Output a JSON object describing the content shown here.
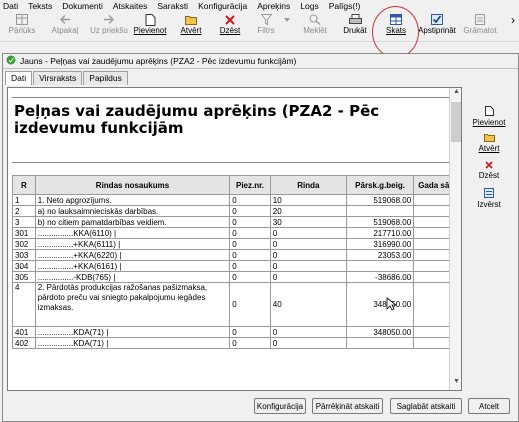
{
  "menu": [
    "Dati",
    "Teksts",
    "Dokumenti",
    "Atskaites",
    "Saraksti",
    "Konfigurācija",
    "Apreķins",
    "Logs",
    "Palīgs(!)"
  ],
  "toolbar": {
    "items": [
      {
        "label": "Pārlūks",
        "icon": "grid-icon",
        "enabled": false
      },
      {
        "label": "Atpakaļ",
        "icon": "arrow-left-icon",
        "enabled": false
      },
      {
        "label": "Uz priekšu",
        "icon": "arrow-right-icon",
        "enabled": false
      },
      {
        "label": "Pievienot",
        "icon": "new-document-icon",
        "enabled": true
      },
      {
        "label": "Atvērt",
        "icon": "open-folder-icon",
        "enabled": true
      },
      {
        "label": "Dzēst",
        "icon": "delete-icon",
        "enabled": true
      },
      {
        "label": "Filtrs",
        "icon": "filter-icon",
        "enabled": false
      },
      {
        "label": "Meklēt",
        "icon": "search-icon",
        "enabled": false
      },
      {
        "label": "Drukāt",
        "icon": "printer-icon",
        "enabled": true
      },
      {
        "label": "Skats",
        "icon": "table-view-icon",
        "enabled": true
      },
      {
        "label": "Apstiprināt",
        "icon": "approve-icon",
        "enabled": true
      },
      {
        "label": "Grāmatot",
        "icon": "ledger-icon",
        "enabled": false
      }
    ]
  },
  "window": {
    "title": "Jauns - Peļņas vai zaudējumu aprēķins (PZA2 - Pēc izdevumu funkcijām)",
    "tabs": [
      "Dati",
      "Virsraksts",
      "Papildus"
    ]
  },
  "report": {
    "title": "Peļņas vai zaudējumu aprēķins (PZA2 - Pēc izdevumu funkcijām",
    "headers": [
      "R",
      "Rindas nosaukums",
      "Piez.nr.",
      "Rinda",
      "Pārsk.g.beig.",
      "Gada sāk."
    ],
    "rows": [
      [
        "1",
        "1. Neto apgrozījums.",
        "0",
        "10",
        "519068.00",
        ""
      ],
      [
        "2",
        "a) no lauksaimnieciskās darbības.",
        "0",
        "20",
        "",
        ""
      ],
      [
        "3",
        "b) no citiem pamatdarbības veidiem.",
        "0",
        "30",
        "519068.00",
        ""
      ],
      [
        "301",
        "................KKA(6110) |",
        "0",
        "0",
        "217710.00",
        ""
      ],
      [
        "302",
        "................+KKA(6111) |",
        "0",
        "0",
        "316990.00",
        ""
      ],
      [
        "303",
        "................+KKA(6220) |",
        "0",
        "0",
        "23053.00",
        ""
      ],
      [
        "304",
        "................+KKA(6161) |",
        "0",
        "0",
        "",
        ""
      ],
      [
        "305",
        "................-KDB(765) |",
        "0",
        "0",
        "-38686.00",
        ""
      ],
      [
        "4",
        "2. Pārdotās produkcijas ražošanas pašizmaksa, pārdoto preču vai sniegto pakalpojumu iegādes izmaksas.",
        "0",
        "40",
        "348050.00",
        ""
      ],
      [
        "401",
        "................KDA(71) |",
        "0",
        "0",
        "348050.00",
        ""
      ],
      [
        "402",
        "................KDA(71) |",
        "0",
        "0",
        "",
        ""
      ]
    ]
  },
  "side_buttons": [
    {
      "label": "Pievienot",
      "icon": "new-document-icon",
      "enabled": true
    },
    {
      "label": "Atvērt",
      "icon": "open-folder-icon",
      "enabled": true
    },
    {
      "label": "Dzēst",
      "icon": "delete-icon",
      "enabled": true
    },
    {
      "label": "Izvērst",
      "icon": "expand-icon",
      "enabled": true
    }
  ],
  "bottom_buttons": [
    "Konfigurācija",
    "Pārrēķināt atskaiti",
    "Saglabāt atskaiti",
    "Atcelt"
  ]
}
